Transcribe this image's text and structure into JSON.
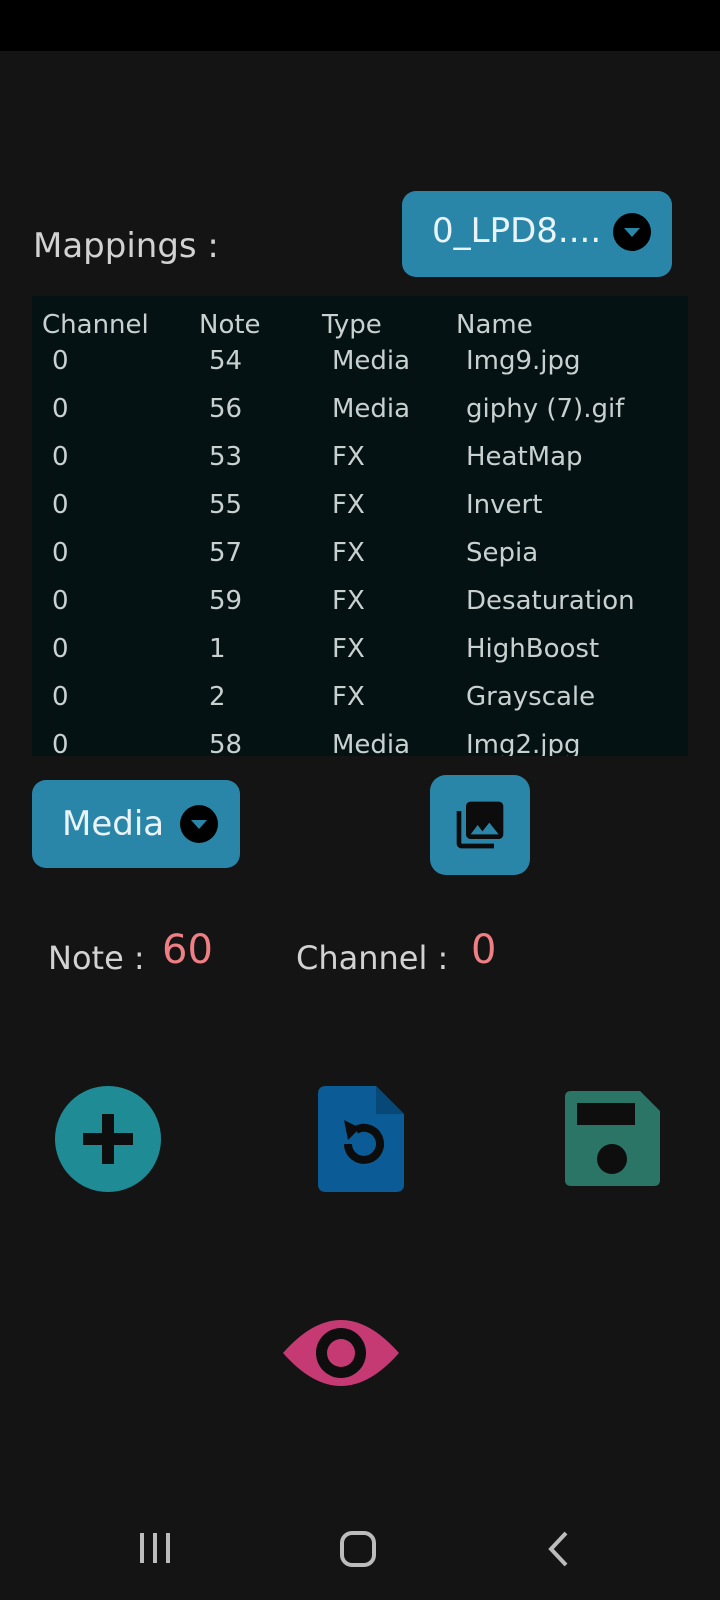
{
  "header": {
    "mappings_label": "Mappings :",
    "device_select_value": "0_LPD8...."
  },
  "table": {
    "columns": [
      "Channel",
      "Note",
      "Type",
      "Name"
    ],
    "rows": [
      {
        "channel": "0",
        "note": "54",
        "type": "Media",
        "name": "Img9.jpg"
      },
      {
        "channel": "0",
        "note": "56",
        "type": "Media",
        "name": "giphy (7).gif"
      },
      {
        "channel": "0",
        "note": "53",
        "type": "FX",
        "name": "HeatMap"
      },
      {
        "channel": "0",
        "note": "55",
        "type": "FX",
        "name": "Invert"
      },
      {
        "channel": "0",
        "note": "57",
        "type": "FX",
        "name": "Sepia"
      },
      {
        "channel": "0",
        "note": "59",
        "type": "FX",
        "name": "Desaturation"
      },
      {
        "channel": "0",
        "note": "1",
        "type": "FX",
        "name": "HighBoost"
      },
      {
        "channel": "0",
        "note": "2",
        "type": "FX",
        "name": "Grayscale"
      },
      {
        "channel": "0",
        "note": "58",
        "type": "Media",
        "name": "Img2.jpg"
      }
    ]
  },
  "controls": {
    "type_select_value": "Media",
    "gallery_icon": "photo-library-icon",
    "note_label": "Note :",
    "note_value": "60",
    "channel_label": "Channel :",
    "channel_value": "0"
  },
  "actions": {
    "add_icon": "add-circle-icon",
    "reload_icon": "file-reload-icon",
    "save_icon": "floppy-disk-icon",
    "preview_icon": "eye-icon"
  },
  "navigation": {
    "recents_icon": "recents-icon",
    "home_icon": "home-icon",
    "back_icon": "back-icon"
  },
  "colors": {
    "background": "#141414",
    "accent_blue": "#2a86a9",
    "table_background": "#051213",
    "value_red": "#ef7f85",
    "add_teal": "#1e8b95",
    "reload_blue": "#0b5c96",
    "save_green": "#2a7565",
    "preview_pink": "#c63a73"
  }
}
